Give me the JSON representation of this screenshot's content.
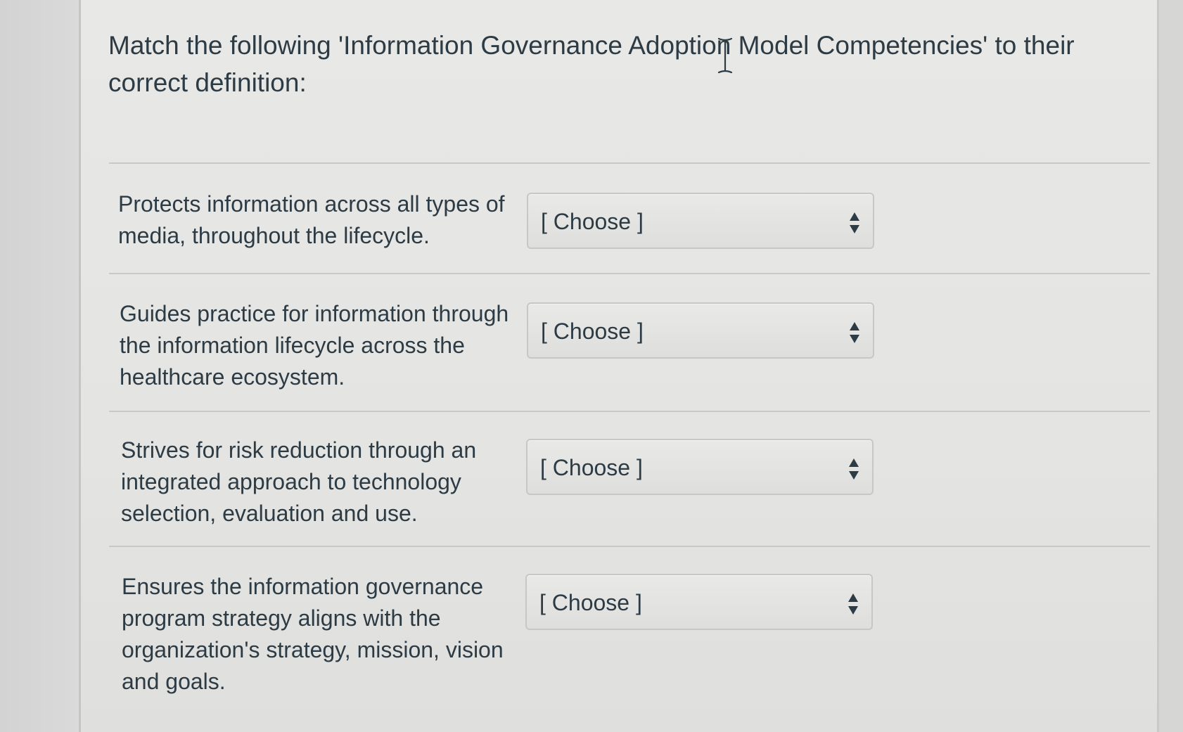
{
  "question": {
    "text": "Match the following 'Information Governance Adoption Model Competencies' to their correct definition:"
  },
  "matches": [
    {
      "prompt": "Protects information across all types of media, throughout the lifecycle.",
      "selected": "[ Choose ]"
    },
    {
      "prompt": "Guides practice for information through the information lifecycle across the healthcare ecosystem.",
      "selected": "[ Choose ]"
    },
    {
      "prompt": "Strives for risk reduction through an integrated approach to technology selection, evaluation and use.",
      "selected": "[ Choose ]"
    },
    {
      "prompt": "Ensures the information governance program strategy aligns with the organization's strategy, mission, vision and goals.",
      "selected": "[ Choose ]"
    }
  ],
  "colors": {
    "text": "#2d3b45",
    "panel": "#e6e6e4",
    "border": "#c7c8c6"
  },
  "icons": {
    "select": "up-down-arrows-icon",
    "cursor": "text-cursor-icon"
  }
}
